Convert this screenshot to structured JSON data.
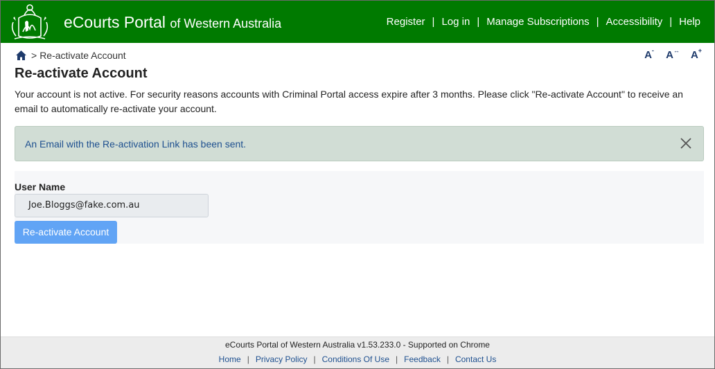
{
  "header": {
    "brand_main": "eCourts Portal",
    "brand_sub": "of Western Australia",
    "nav": [
      {
        "label": "Register"
      },
      {
        "label": "Log in"
      },
      {
        "label": "Manage Subscriptions"
      },
      {
        "label": "Accessibility"
      },
      {
        "label": "Help"
      }
    ],
    "nav_separator": "|",
    "background_color": "#007a00"
  },
  "breadcrumb": {
    "home_icon": "home-icon",
    "separator": ">",
    "current": "Re-activate Account"
  },
  "font_size_controls": {
    "decrease": "A",
    "reset": "A",
    "increase": "A",
    "decrease_mark": "-",
    "reset_mark": "↔",
    "increase_mark": "+"
  },
  "main": {
    "title": "Re-activate Account",
    "intro": "Your account is not active. For security reasons accounts with Criminal Portal access expire after 3 months. Please click \"Re-activate Account\" to receive an email to automatically re-activate your account."
  },
  "alert": {
    "message": "An Email with the Re-activation Link has been sent.",
    "close_icon": "close-icon",
    "background_color": "#d1ddd5"
  },
  "form": {
    "username_label": "User Name",
    "username_value": "Joe.Bloggs@fake.com.au",
    "submit_label": "Re-activate Account",
    "submit_color": "#61a4f5"
  },
  "footer": {
    "version_text": "eCourts Portal of Western Australia v1.53.233.0 - Supported on Chrome",
    "links": [
      {
        "label": "Home"
      },
      {
        "label": "Privacy Policy"
      },
      {
        "label": "Conditions Of Use"
      },
      {
        "label": "Feedback"
      },
      {
        "label": "Contact Us"
      }
    ],
    "separator": "|"
  }
}
